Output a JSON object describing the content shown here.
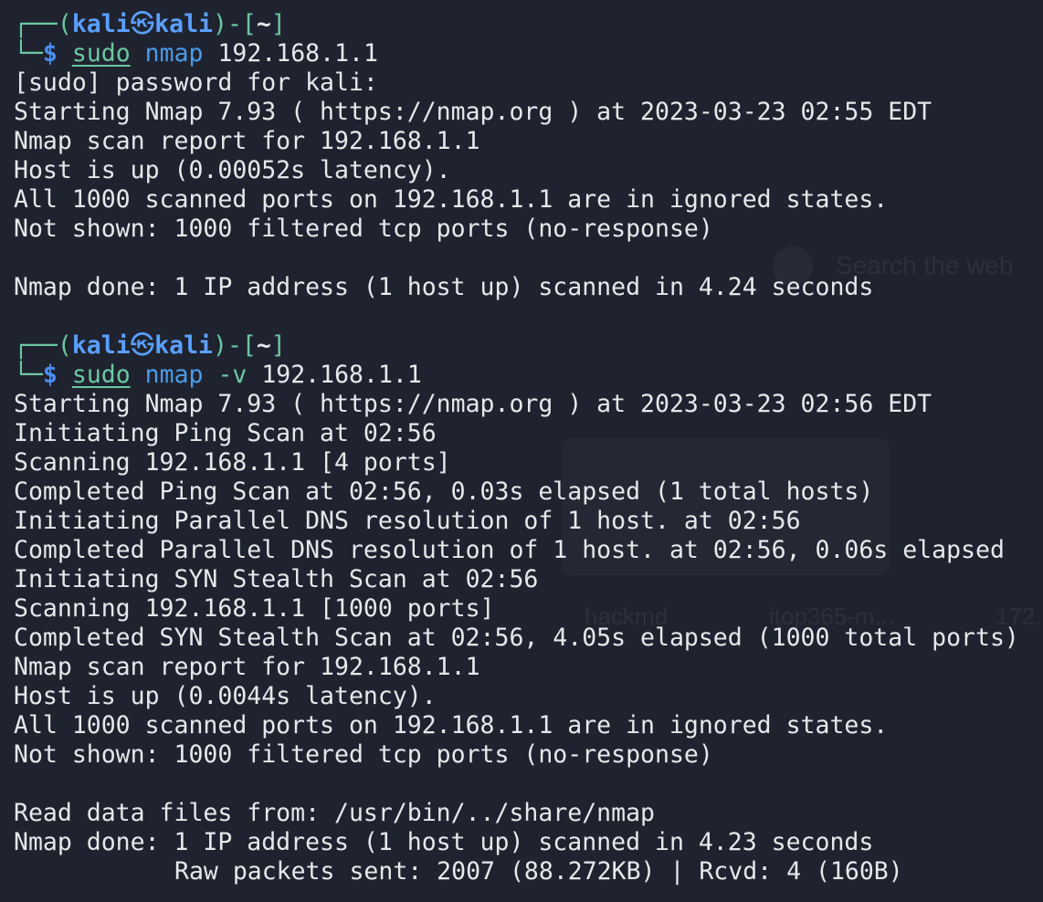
{
  "prompt": {
    "open": "┌──(",
    "user": "kali",
    "skull": "㉿",
    "host": "kali",
    "mid": ")-[",
    "dir": "~",
    "close": "]",
    "corner": "└─",
    "dollar": "$"
  },
  "commands": [
    {
      "sudo": "sudo",
      "cmd": "nmap",
      "args": " 192.168.1.1"
    },
    {
      "sudo": "sudo",
      "cmd": "nmap",
      "args": " -v",
      "target": " 192.168.1.1"
    }
  ],
  "output1": [
    "[sudo] password for kali:",
    "Starting Nmap 7.93 ( https://nmap.org ) at 2023-03-23 02:55 EDT",
    "Nmap scan report for 192.168.1.1",
    "Host is up (0.00052s latency).",
    "All 1000 scanned ports on 192.168.1.1 are in ignored states.",
    "Not shown: 1000 filtered tcp ports (no-response)",
    "",
    "Nmap done: 1 IP address (1 host up) scanned in 4.24 seconds"
  ],
  "output2": [
    "Starting Nmap 7.93 ( https://nmap.org ) at 2023-03-23 02:56 EDT",
    "Initiating Ping Scan at 02:56",
    "Scanning 192.168.1.1 [4 ports]",
    "Completed Ping Scan at 02:56, 0.03s elapsed (1 total hosts)",
    "Initiating Parallel DNS resolution of 1 host. at 02:56",
    "Completed Parallel DNS resolution of 1 host. at 02:56, 0.06s elapsed",
    "Initiating SYN Stealth Scan at 02:56",
    "Scanning 192.168.1.1 [1000 ports]",
    "Completed SYN Stealth Scan at 02:56, 4.05s elapsed (1000 total ports)",
    "Nmap scan report for 192.168.1.1",
    "Host is up (0.0044s latency).",
    "All 1000 scanned ports on 192.168.1.1 are in ignored states.",
    "Not shown: 1000 filtered tcp ports (no-response)",
    "",
    "Read data files from: /usr/bin/../share/nmap",
    "Nmap done: 1 IP address (1 host up) scanned in 4.23 seconds"
  ],
  "raw_packets": "Raw packets sent: 2007 (88.272KB) | Rcvd: 4 (160B)",
  "background": {
    "search_hint": "Search the web",
    "shortcuts": [
      "hackmd",
      "itop365-m...",
      "172."
    ]
  },
  "colors": {
    "background": "#1f2330",
    "prompt_frame": "#6cc8a0",
    "prompt_user": "#5aa0ff",
    "command": "#4a9be8",
    "text": "#e6e8ea"
  }
}
